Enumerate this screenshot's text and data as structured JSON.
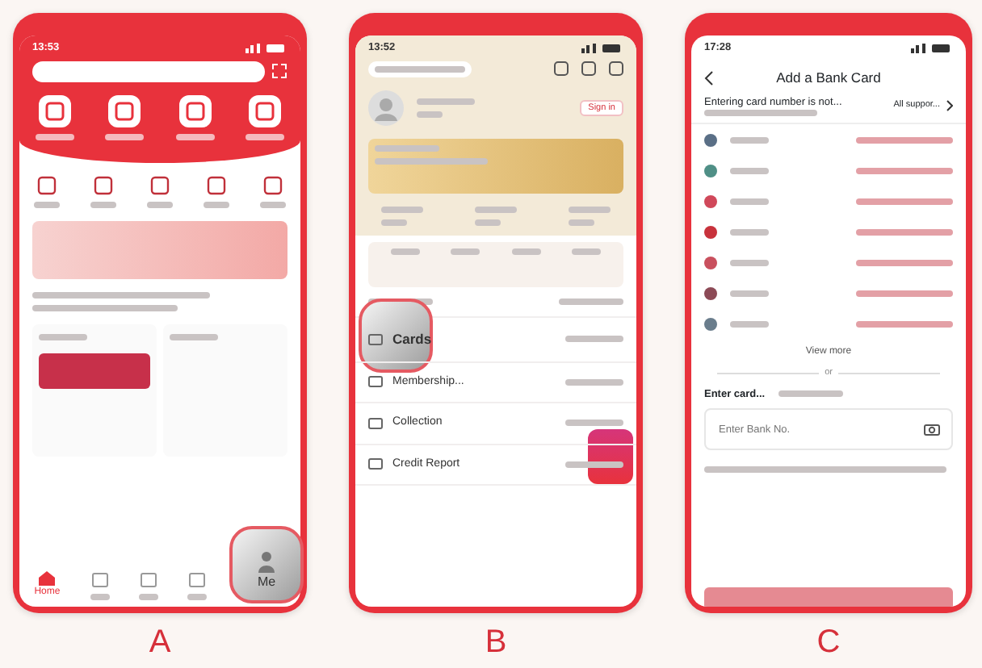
{
  "panels": [
    {
      "caption": "A",
      "kind": "home",
      "time": "13:53",
      "nav_active": "Home",
      "callout": "Me"
    },
    {
      "caption": "B",
      "kind": "me",
      "time": "13:52",
      "sign_in": "Sign in",
      "menu": [
        {
          "label": "Cards",
          "highlighted": true
        },
        {
          "label": "Membership...",
          "highlighted": false
        },
        {
          "label": "Collection",
          "highlighted": false
        },
        {
          "label": "Credit Report",
          "highlighted": false
        }
      ]
    },
    {
      "caption": "C",
      "kind": "bank_card",
      "time": "17:28",
      "title": "Add a Bank Card",
      "notice": "Entering card number is not...",
      "support_link": "All suppor...",
      "banks": [
        {
          "color": "#5a6f86"
        },
        {
          "color": "#4f8f86"
        },
        {
          "color": "#d0485a"
        },
        {
          "color": "#c8323c"
        },
        {
          "color": "#c9505e"
        },
        {
          "color": "#8c4a56"
        },
        {
          "color": "#6a7d8c"
        }
      ],
      "view_more": "View more",
      "divider": "or",
      "enter_label": "Enter card...",
      "placeholder": "Enter Bank No."
    }
  ]
}
